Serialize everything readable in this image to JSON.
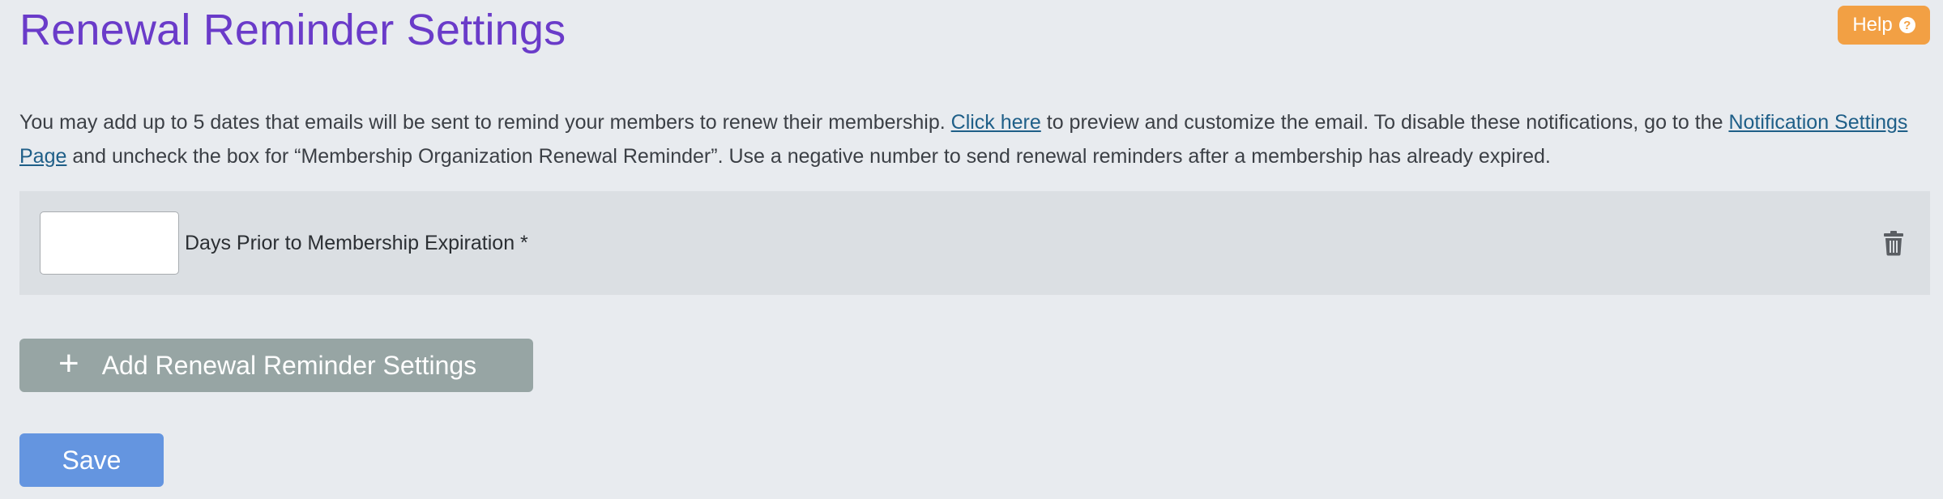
{
  "page": {
    "title": "Renewal Reminder Settings"
  },
  "help": {
    "label": "Help",
    "icon": "question-circle-icon",
    "icon_glyph": "?",
    "color": "#f2a044"
  },
  "intro": {
    "text_1": "You may add up to 5 dates that emails will be sent to remind your members to renew their membership. ",
    "link_1": "Click here",
    "text_2": " to preview and customize the email. To disable these notifications, go to the ",
    "link_2": "Notification Settings Page",
    "text_3": " and uncheck the box for “Membership Organization Renewal Reminder”. Use a negative number to send renewal reminders after a membership has already expired."
  },
  "reminders": [
    {
      "days_value": "",
      "label": "Days Prior to Membership Expiration *",
      "delete_icon": "trash-icon"
    }
  ],
  "actions": {
    "add_label": "Add Renewal Reminder Settings",
    "add_icon": "plus-icon",
    "add_glyph": "+",
    "save_label": "Save"
  },
  "colors": {
    "title": "#6a3bc9",
    "link": "#1f5f88",
    "add_button": "#97a5a4",
    "save_button": "#6495e0",
    "background": "#e8ebef"
  }
}
